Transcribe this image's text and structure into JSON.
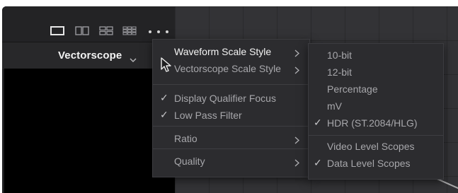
{
  "panel": {
    "scope_title": "Vectorscope",
    "layout_buttons": [
      {
        "icon": "single-layout-icon"
      },
      {
        "icon": "dual-layout-icon"
      },
      {
        "icon": "quad-layout-icon"
      },
      {
        "icon": "grid-layout-icon"
      }
    ],
    "more_icon": "more-options-icon"
  },
  "main_menu": {
    "items": [
      {
        "label": "Waveform Scale Style",
        "checked": false,
        "submenu": true,
        "active": true
      },
      {
        "label": "Vectorscope Scale Style",
        "checked": false,
        "submenu": true
      },
      {
        "label": "Display Qualifier Focus",
        "checked": true,
        "submenu": false
      },
      {
        "label": "Low Pass Filter",
        "checked": true,
        "submenu": false
      },
      {
        "label": "Ratio",
        "checked": false,
        "submenu": true
      },
      {
        "label": "Quality",
        "checked": false,
        "submenu": true
      }
    ],
    "check_glyph": "✓"
  },
  "sub_menu": {
    "items": [
      {
        "label": "10-bit",
        "checked": false
      },
      {
        "label": "12-bit",
        "checked": false
      },
      {
        "label": "Percentage",
        "checked": false
      },
      {
        "label": "mV",
        "checked": false
      },
      {
        "label": "HDR (ST.2084/HLG)",
        "checked": true
      },
      {
        "label": "Video Level Scopes",
        "checked": false
      },
      {
        "label": "Data Level Scopes",
        "checked": true
      }
    ],
    "check_glyph": "✓"
  },
  "colors": {
    "panel_bg": "#1f1f21",
    "menu_bg": "#2c2c2f",
    "menu_text": "#a7a7ab",
    "active_text": "#f4f4f4"
  }
}
